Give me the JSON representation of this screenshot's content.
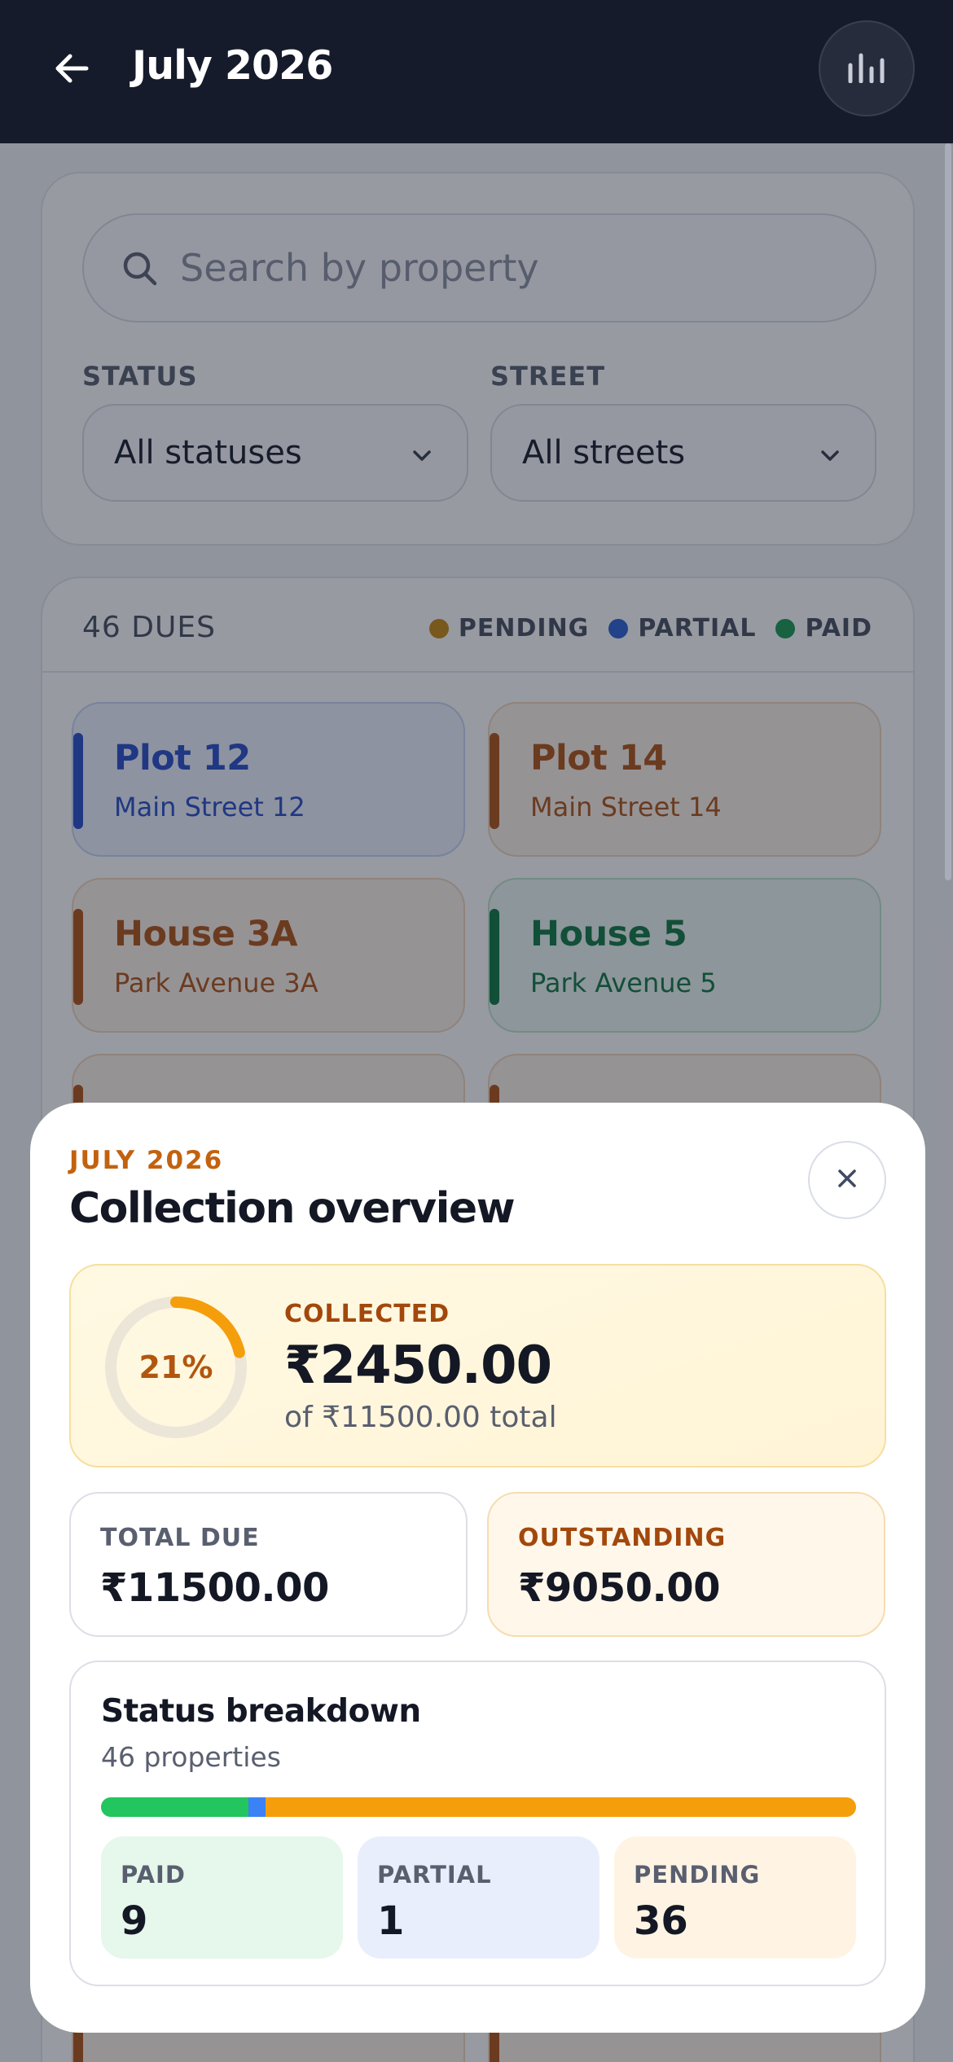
{
  "appbar": {
    "title": "July 2026",
    "back_icon": "arrow-left-icon",
    "stats_icon": "bar-chart-icon",
    "background": "#161b2b"
  },
  "filters": {
    "search_placeholder": "Search by property",
    "status_label": "STATUS",
    "status_value": "All statuses",
    "street_label": "STREET",
    "street_value": "All streets"
  },
  "dues": {
    "count_label": "46 DUES",
    "legend": [
      {
        "label": "PENDING",
        "color": "#c98a14"
      },
      {
        "label": "PARTIAL",
        "color": "#2f62d4"
      },
      {
        "label": "PAID",
        "color": "#1e9a55"
      }
    ],
    "items": [
      {
        "name": "Plot 12",
        "street": "Main Street 12",
        "status": "partial"
      },
      {
        "name": "Plot 14",
        "street": "Main Street 14",
        "status": "pending"
      },
      {
        "name": "House 3A",
        "street": "Park Avenue 3A",
        "status": "pending"
      },
      {
        "name": "House 5",
        "street": "Park Avenue 5",
        "status": "paid"
      }
    ]
  },
  "overview": {
    "period_label": "JULY 2026",
    "title": "Collection overview",
    "collected": {
      "label": "COLLECTED",
      "amount": "₹2450.00",
      "total_text": "of ₹11500.00 total",
      "percent_label": "21%",
      "fraction": 0.213
    },
    "total_due": {
      "label": "TOTAL DUE",
      "value": "₹11500.00"
    },
    "outstanding": {
      "label": "OUTSTANDING",
      "value": "₹9050.00"
    },
    "breakdown": {
      "title": "Status breakdown",
      "subtitle": "46 properties",
      "segments": [
        {
          "key": "paid",
          "label": "PAID",
          "value": "9",
          "count": 9,
          "color": "#22c55e"
        },
        {
          "key": "partial",
          "label": "PARTIAL",
          "value": "1",
          "count": 1,
          "color": "#3b82f6"
        },
        {
          "key": "pending",
          "label": "PENDING",
          "value": "36",
          "count": 36,
          "color": "#f59e0b"
        }
      ]
    }
  },
  "colors": {
    "accent_orange": "#f59e0b",
    "eyebrow_orange": "#c2620f",
    "scrim": "#131828"
  }
}
